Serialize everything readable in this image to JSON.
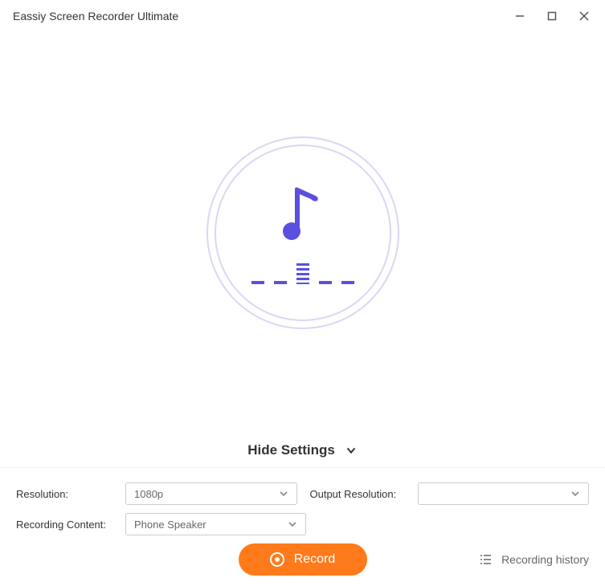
{
  "window": {
    "title": "Eassiy Screen Recorder Ultimate"
  },
  "main": {
    "visual": "audio-recorder"
  },
  "toggle": {
    "label": "Hide Settings"
  },
  "settings": {
    "resolution_label": "Resolution:",
    "resolution_value": "1080p",
    "output_resolution_label": "Output Resolution:",
    "output_resolution_value": "",
    "recording_content_label": "Recording Content:",
    "recording_content_value": "Phone Speaker"
  },
  "footer": {
    "record_label": "Record",
    "history_label": "Recording history"
  },
  "colors": {
    "accent": "#5B4FE0",
    "primary_action": "#FF7A1A",
    "circle_ring": "#D9D7F5"
  }
}
